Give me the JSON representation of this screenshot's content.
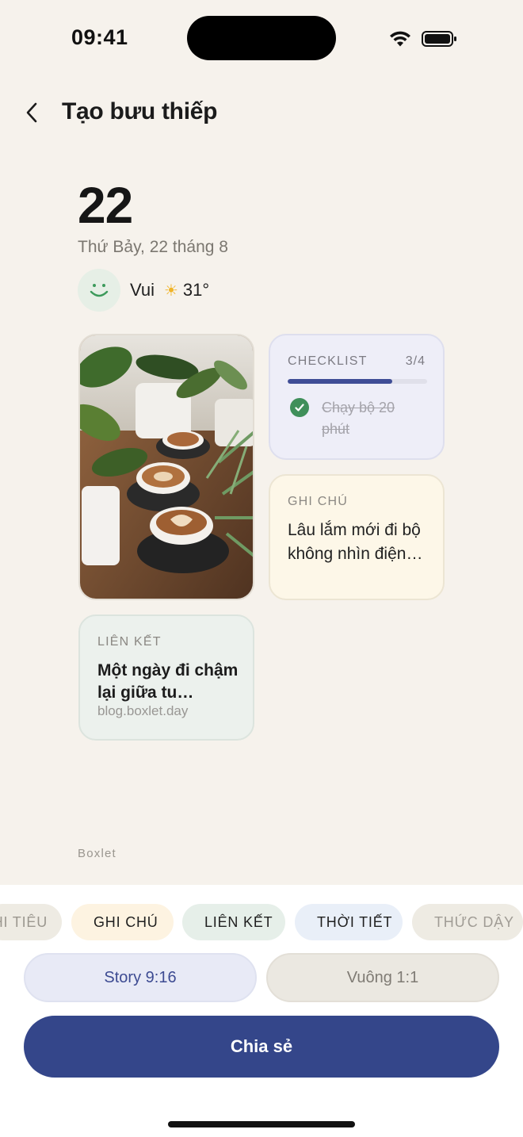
{
  "status_bar": {
    "time": "09:41"
  },
  "header": {
    "title": "Tạo bưu thiếp",
    "back_icon": "chevron-left-icon"
  },
  "postcard": {
    "day": "22",
    "date": "Thứ Bảy, 22 tháng 8",
    "mood": "Vui",
    "weather_icon": "sun-icon",
    "temperature": "31°",
    "photo": "latte-coffee-plants-photo",
    "checklist": {
      "label": "CHECKLIST",
      "count": "3/4",
      "progress_fraction": 0.75,
      "item": "Chạy bộ 20 phút"
    },
    "note": {
      "label": "GHI CHÚ",
      "text": "Lâu lắm mới đi bộ không nhìn điện…"
    },
    "link": {
      "label": "LIÊN KẾT",
      "title": "Một ngày đi chậm lại giữa tu…",
      "url": "blog.boxlet.day"
    },
    "brand": "Boxlet"
  },
  "chips": [
    {
      "label": "HI TIÊU",
      "dot": ""
    },
    {
      "label": "GHI CHÚ",
      "dot": "#e09a2a"
    },
    {
      "label": "LIÊN KẾT",
      "dot": "#3f8f6e"
    },
    {
      "label": "THỜI TIẾT",
      "dot": "#3e6fb8"
    },
    {
      "label": "THỨC DẬY",
      "dot": "#dcd9d2"
    }
  ],
  "format": {
    "story": "Story 9:16",
    "square": "Vuông 1:1",
    "selected": "Story 9:16"
  },
  "share_label": "Chia sẻ",
  "colors": {
    "accent": "#34468a",
    "background": "#f6f2ec"
  }
}
